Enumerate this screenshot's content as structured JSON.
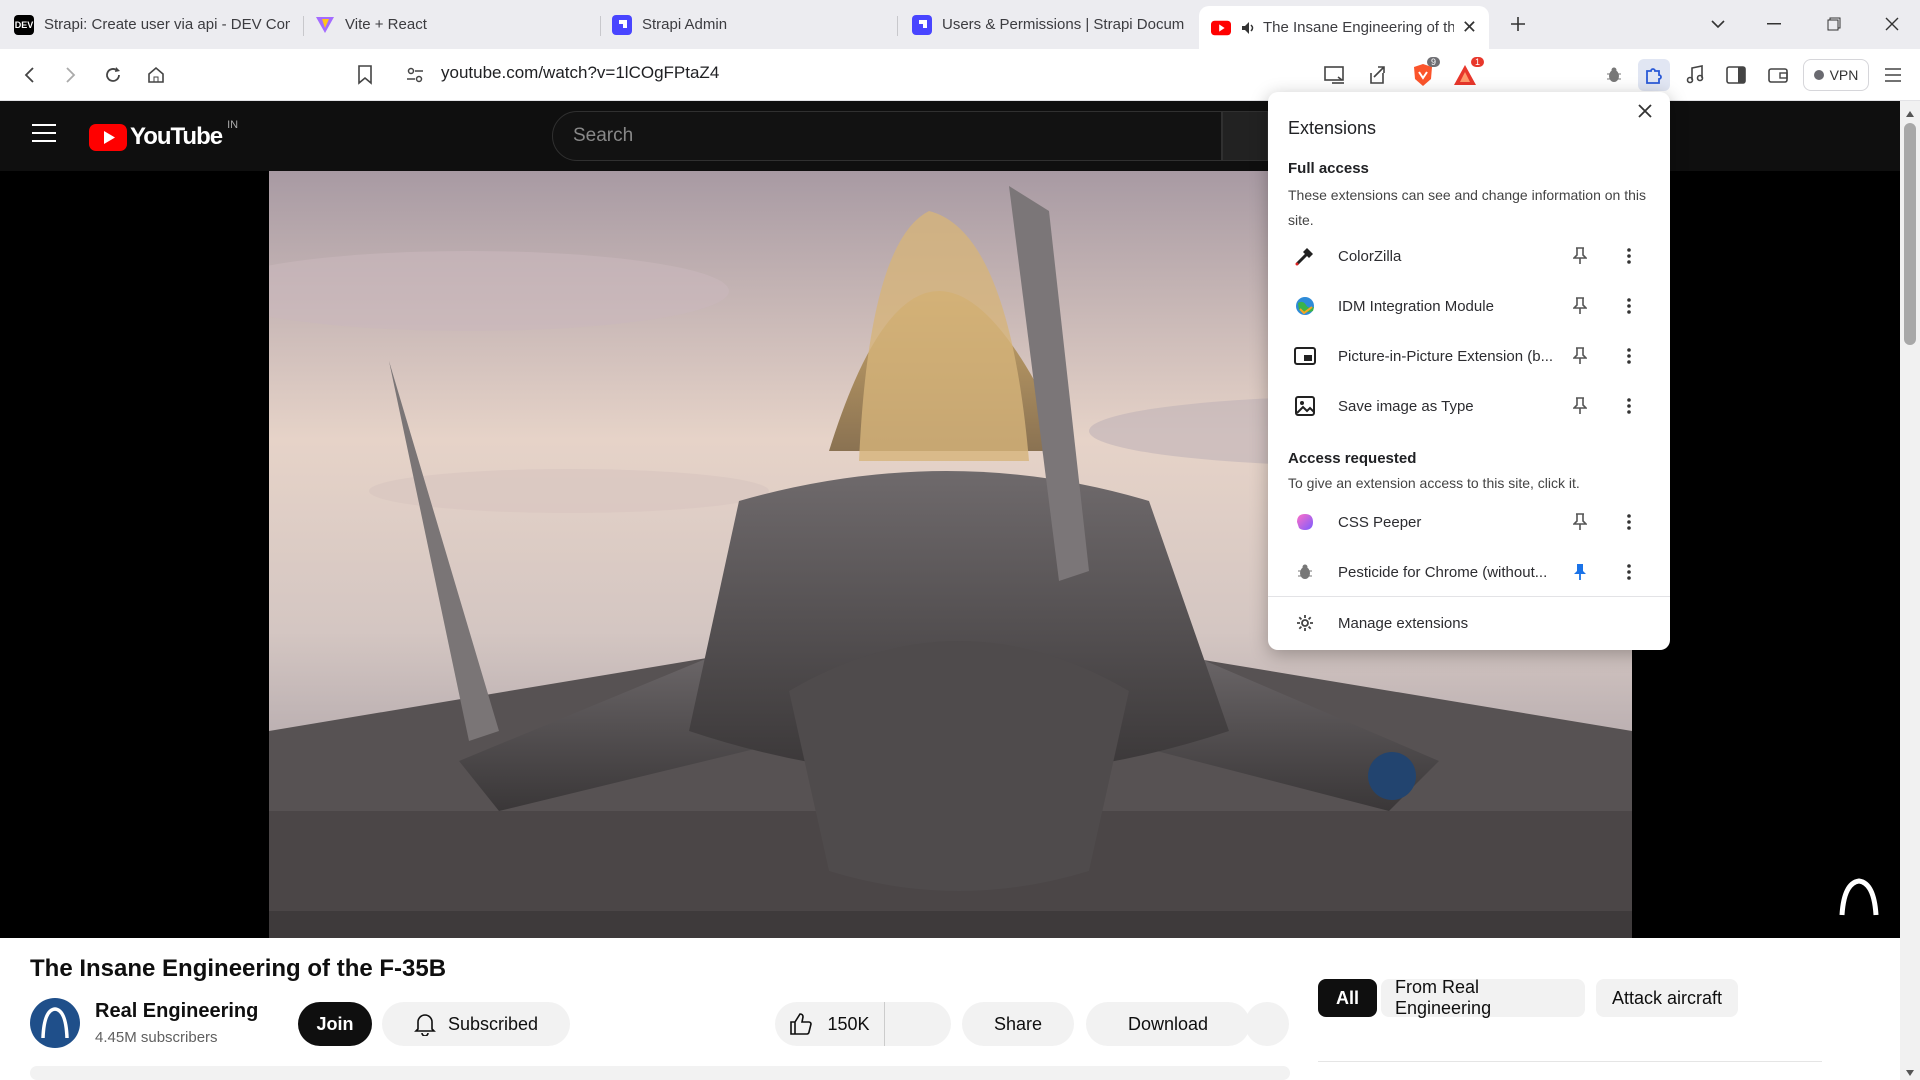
{
  "browser": {
    "tabs": [
      {
        "title": "Strapi: Create user via api - DEV Com",
        "favicon": "DEV"
      },
      {
        "title": "Vite + React",
        "favicon": "vite-icon"
      },
      {
        "title": "Strapi Admin",
        "favicon": "strapi-icon"
      },
      {
        "title": "Users & Permissions | Strapi Docume",
        "favicon": "strapi-icon"
      },
      {
        "title": "The Insane Engineering of th",
        "favicon": "youtube-icon",
        "active": true,
        "audio": true
      }
    ],
    "url": "youtube.com/watch?v=1lCOgFPtaZ4",
    "shield_badge": "9",
    "alert_badge": "1",
    "vpn_label": "VPN"
  },
  "youtube": {
    "logo_text": "YouTube",
    "region": "IN",
    "search_placeholder": "Search",
    "video_title": "The Insane Engineering of the F-35B",
    "channel_name": "Real Engineering",
    "subscribers": "4.45M subscribers",
    "join_label": "Join",
    "subscribed_label": "Subscribed",
    "like_count": "150K",
    "share_label": "Share",
    "download_label": "Download",
    "chips": [
      "All",
      "From Real Engineering",
      "Attack aircraft"
    ]
  },
  "extensions_panel": {
    "title": "Extensions",
    "full_access_heading": "Full access",
    "full_access_desc": "These extensions can see and change information on this site.",
    "full_access_items": [
      {
        "name": "ColorZilla",
        "icon": "eyedropper-icon",
        "pinned": false
      },
      {
        "name": "IDM Integration Module",
        "icon": "globe-icon",
        "pinned": false
      },
      {
        "name": "Picture-in-Picture Extension (b...",
        "icon": "pip-icon",
        "pinned": false
      },
      {
        "name": "Save image as Type",
        "icon": "image-icon",
        "pinned": false
      }
    ],
    "access_requested_heading": "Access requested",
    "access_requested_desc": "To give an extension access to this site, click it.",
    "requested_items": [
      {
        "name": "CSS Peeper",
        "icon": "peeper-icon",
        "pinned": false
      },
      {
        "name": "Pesticide for Chrome (without...",
        "icon": "bug-icon",
        "pinned": true
      }
    ],
    "manage_label": "Manage extensions"
  },
  "colors": {
    "youtube_red": "#ff0000",
    "pin_active": "#1a73e8",
    "brave_orange": "#fb542b"
  }
}
